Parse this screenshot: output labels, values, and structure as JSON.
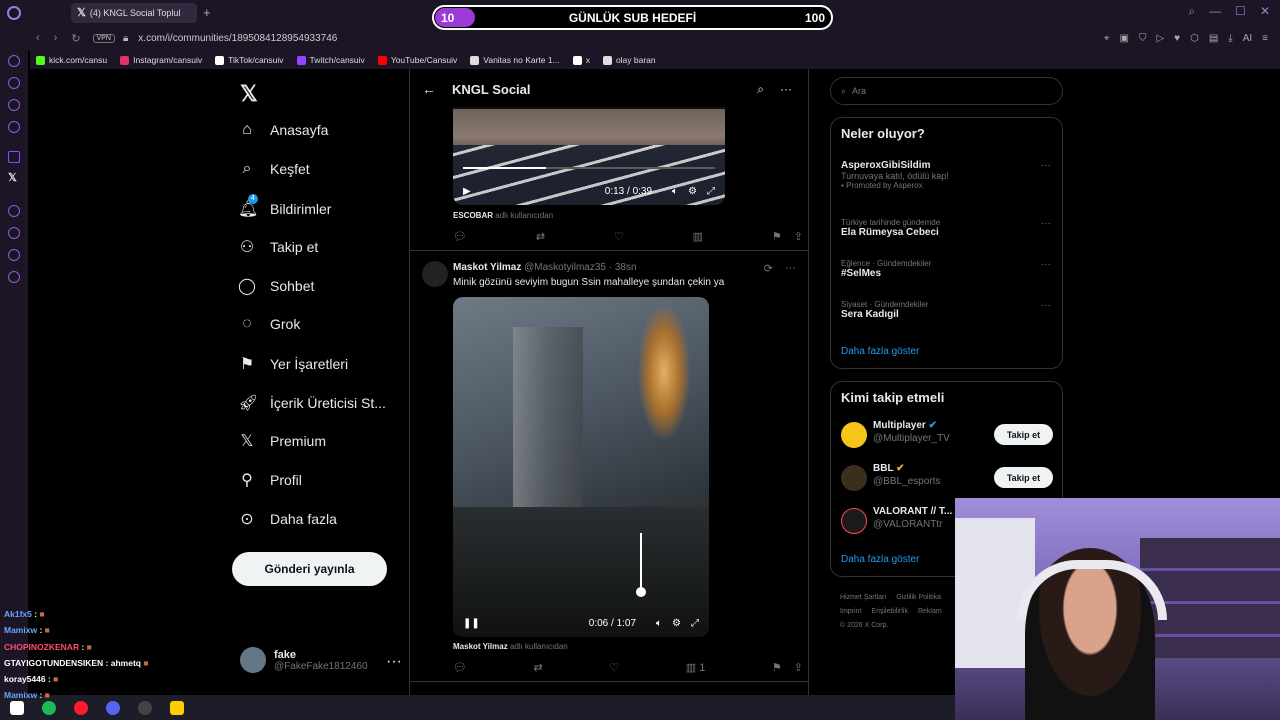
{
  "browser": {
    "tab_title": "(4) KNGL Social Toplul",
    "url": "x.com/i/communities/1895084128954933746",
    "vpn": "VPN",
    "bookmarks": [
      "kick.com/cansu",
      "Instagram/cansuiv",
      "TikTok/cansuiv",
      "Twitch/cansuiv",
      "YouTube/Cansuiv",
      "Vanitas no Karte 1...",
      "x",
      "olay baran"
    ],
    "bookmark_colors": [
      "#53fc18",
      "#e1306c",
      "#ffffff",
      "#9146ff",
      "#ff0000",
      "#dddddd",
      "#ffffff",
      "#dddddd"
    ]
  },
  "sub_goal": {
    "current": "10",
    "label": "GÜNLÜK SUB HEDEFİ",
    "max": "100",
    "progress": 0.1
  },
  "nav": {
    "items": [
      "Anasayfa",
      "Keşfet",
      "Bildirimler",
      "Takip et",
      "Sohbet",
      "Grok",
      "Yer İşaretleri",
      "İçerik Üreticisi St...",
      "Premium",
      "Profil",
      "Daha fazla"
    ],
    "icons": [
      "home-icon",
      "search-icon",
      "bell-icon",
      "person-add-icon",
      "chat-icon",
      "grok-icon",
      "bookmark-icon",
      "rocket-icon",
      "x-icon",
      "profile-icon",
      "more-circle-icon"
    ],
    "notification_count": "4",
    "post_button": "Gönderi yayınla",
    "account_name": "fake",
    "account_handle": "@FakeFake1812460"
  },
  "timeline": {
    "title": "KNGL Social",
    "video1": {
      "time": "0:13 / 0:39",
      "progress": 0.33
    },
    "video1_credit_name": "ESCOBAR",
    "video1_credit_suffix": "adlı kullanıcıdan",
    "post2": {
      "name": "Maskot Yilmaz",
      "handle": "@Maskotyilmaz35 · 38sn",
      "text": "Minik gözünü seviyim bugun Ssin mahalleye şundan çekin ya",
      "video_time": "0:06 / 1:07",
      "credit_name": "Maskot Yilmaz",
      "credit_suffix": "adlı kullanıcıdan",
      "views": "1"
    }
  },
  "right": {
    "search_placeholder": "Ara",
    "trends_title": "Neler oluyor?",
    "trends": [
      {
        "ctx": "",
        "name": "AsperoxGibiSildim",
        "desc": "Turnuvaya katıl, ödülü kap!",
        "promo": "Promoted by Asperox"
      },
      {
        "ctx": "Türkiye tarihinde gündemde",
        "name": "Ela Rümeysa Cebeci",
        "desc": "",
        "promo": ""
      },
      {
        "ctx": "Eğlence · Gündemdekiler",
        "name": "#SelMes",
        "desc": "",
        "promo": ""
      },
      {
        "ctx": "Siyaset · Gündemdekiler",
        "name": "Sera Kadıgil",
        "desc": "",
        "promo": ""
      }
    ],
    "show_more": "Daha fazla göster",
    "follow_title": "Kimi takip etmeli",
    "follow": [
      {
        "name": "Multiplayer",
        "handle": "@Multiplayer_TV",
        "btn": "Takip et"
      },
      {
        "name": "BBL",
        "handle": "@BBL_esports",
        "btn": "Takip et"
      },
      {
        "name": "VALORANT // T...",
        "handle": "@VALORANTtr",
        "btn": ""
      }
    ],
    "follow_show_more": "Daha fazla göster",
    "footer": [
      "Hizmet Şartları",
      "Gizlilik Politika",
      "Imprint",
      "Erişilebilirlik",
      "Reklam",
      "© 2026 X Corp."
    ]
  },
  "chat": [
    {
      "user": "Ak1fx5",
      "msg": ":"
    },
    {
      "user": "Mamixw",
      "msg": ":"
    },
    {
      "user": "CHOPINOZKENAR",
      "msg": ":"
    },
    {
      "user": "GTAYIGOTUNDENSIKEN",
      "msg": ": ahmetq"
    },
    {
      "user": "koray5446",
      "msg": ":"
    },
    {
      "user": "Mamixw",
      "msg": ":"
    }
  ],
  "chat_colors": [
    "#6aa4ff",
    "#6aa4ff",
    "#ff4d6d",
    "#ffffff",
    "#ffffff",
    "#6aa4ff"
  ]
}
